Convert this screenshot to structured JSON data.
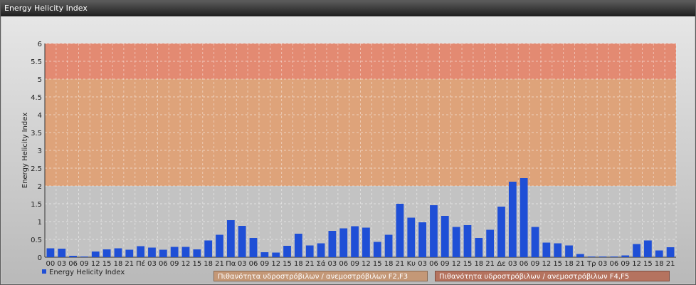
{
  "window": {
    "title": "Energy Helicity Index"
  },
  "legend": {
    "series_label": "Energy Helicity Index"
  },
  "bands": {
    "f2f3_label": "Πιθανότητα υδροστρόβιλων / ανεμοστρόβιλων F2,F3",
    "f4f5_label": "Πιθανότητα υδροστρόβιλων / ανεμοστρόβιλων F4,F5"
  },
  "colors": {
    "bar": "#1f4fd6",
    "band_low": "#c3c3c3",
    "band_mid": "#dea37a",
    "band_high": "#e38a72"
  },
  "chart_data": {
    "type": "bar",
    "ylabel": "Energy Helicity Index",
    "xlabel": "",
    "ylim": [
      0,
      6
    ],
    "yticks": [
      0,
      0.5,
      1,
      1.5,
      2,
      2.5,
      3,
      3.5,
      4,
      4.5,
      5,
      5.5,
      6
    ],
    "ytick_labels": [
      "0",
      "0.5",
      "1",
      "1.5",
      "2",
      "2.5",
      "3",
      "3.5",
      "4",
      "4.5",
      "5",
      "5.5",
      "6"
    ],
    "grid": true,
    "legend_position": "bottom-left",
    "background_bands": [
      {
        "from": 0,
        "to": 2,
        "level": "low"
      },
      {
        "from": 2,
        "to": 5,
        "level": "F2,F3"
      },
      {
        "from": 5,
        "to": 6,
        "level": "F4,F5"
      }
    ],
    "categories": [
      "00",
      "03",
      "06",
      "09",
      "12",
      "15",
      "18",
      "21",
      "Πέ",
      "03",
      "06",
      "09",
      "12",
      "15",
      "18",
      "21",
      "Πα",
      "03",
      "06",
      "09",
      "12",
      "15",
      "18",
      "21",
      "Σά",
      "03",
      "06",
      "09",
      "12",
      "15",
      "18",
      "21",
      "Κυ",
      "03",
      "06",
      "09",
      "12",
      "15",
      "18",
      "21",
      "Δε",
      "03",
      "06",
      "09",
      "12",
      "15",
      "18",
      "21",
      "Τρ",
      "03",
      "06",
      "09",
      "12",
      "15",
      "18",
      "21"
    ],
    "series": [
      {
        "name": "Energy Helicity Index",
        "values": [
          0.25,
          0.24,
          0.04,
          0.02,
          0.16,
          0.22,
          0.25,
          0.21,
          0.31,
          0.27,
          0.21,
          0.29,
          0.29,
          0.22,
          0.47,
          0.63,
          1.04,
          0.88,
          0.54,
          0.14,
          0.13,
          0.32,
          0.66,
          0.33,
          0.39,
          0.74,
          0.81,
          0.87,
          0.83,
          0.43,
          0.63,
          1.5,
          1.11,
          0.98,
          1.46,
          1.16,
          0.85,
          0.9,
          0.54,
          0.77,
          1.42,
          2.12,
          2.22,
          0.85,
          0.41,
          0.39,
          0.33,
          0.09,
          0.02,
          0.02,
          0.02,
          0.05,
          0.37,
          0.47,
          0.19,
          0.28
        ]
      }
    ]
  }
}
